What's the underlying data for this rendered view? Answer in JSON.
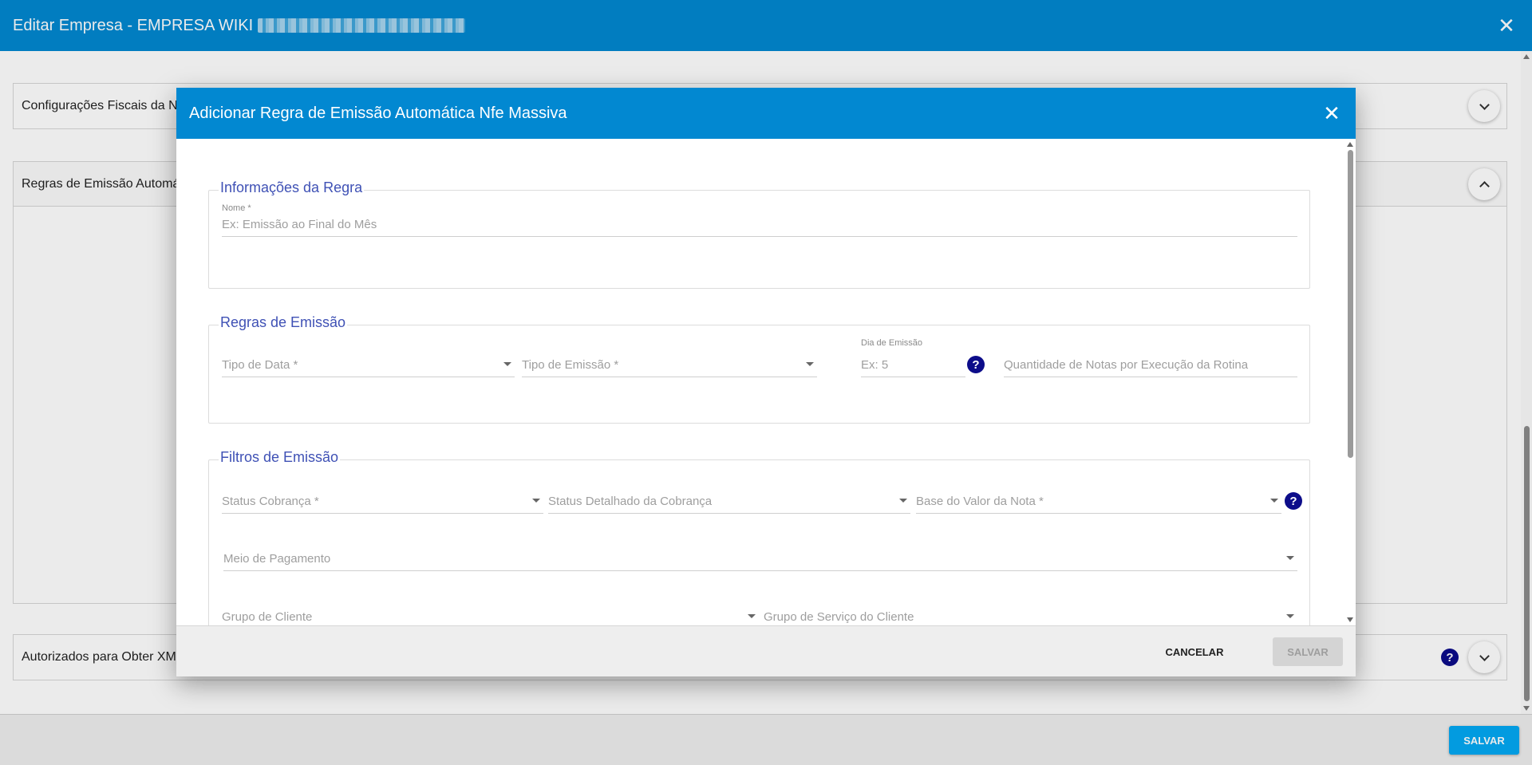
{
  "page": {
    "title": "Editar Empresa - EMPRESA WIKI",
    "close_icon": "✕",
    "panels": {
      "fiscal": {
        "label": "Configurações Fiscais da N"
      },
      "regras": {
        "label": "Regras de Emissão Automá"
      },
      "autorizados": {
        "label": "Autorizados para Obter XML"
      }
    },
    "help_glyph": "?",
    "save_label": "SALVAR"
  },
  "modal": {
    "title": "Adicionar Regra de Emissão Automática Nfe Massiva",
    "close_icon": "✕",
    "sections": {
      "info": {
        "legend": "Informações da Regra",
        "nome_label": "Nome *",
        "nome_placeholder": "Ex: Emissão ao Final do Mês"
      },
      "regras": {
        "legend": "Regras de Emissão",
        "tipo_data": "Tipo de Data *",
        "tipo_emissao": "Tipo de Emissão *",
        "dia_label": "Dia de Emissão",
        "dia_placeholder": "Ex: 5",
        "quantidade": "Quantidade de Notas por Execução da Rotina"
      },
      "filtros": {
        "legend": "Filtros de Emissão",
        "status_cobranca": "Status Cobrança *",
        "status_detalhado": "Status Detalhado da Cobrança",
        "base_valor": "Base do Valor da Nota *",
        "meio_pagamento": "Meio de Pagamento",
        "grupo_cliente": "Grupo de Cliente",
        "grupo_servico": "Grupo de Serviço do Cliente"
      }
    },
    "help_glyph": "?",
    "cancel_label": "CANCELAR",
    "save_label": "SALVAR"
  },
  "colors": {
    "header_blue": "#0288d1",
    "legend_blue": "#3f51b5",
    "help_navy": "#0d0d8a",
    "save_blue": "#03a9f4"
  }
}
